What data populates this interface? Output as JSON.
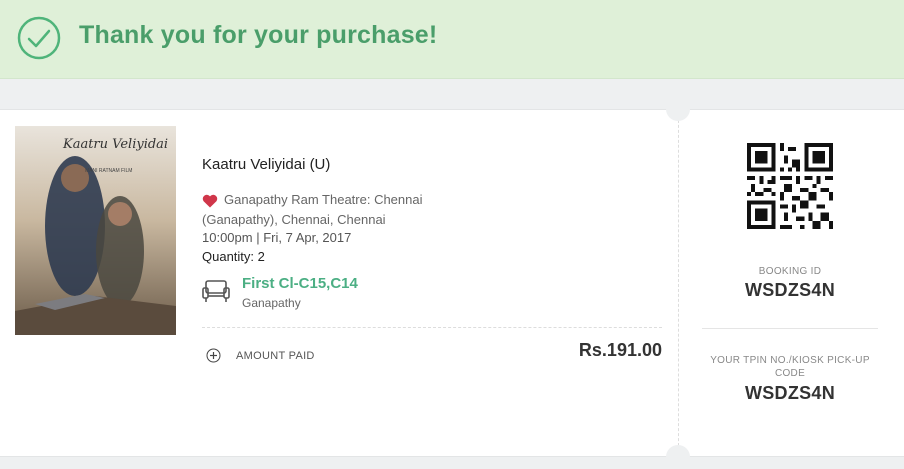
{
  "banner": {
    "title": "Thank you for your purchase!",
    "icon": "check-circle-icon",
    "color": "#4a9e6a"
  },
  "movie": {
    "title": "Kaatru Veliyidai (U)",
    "poster_title": "Kaatru Veliyidai",
    "poster_subtitle": "MANI RATNAM FILM",
    "theatre_line1": "Ganapathy Ram Theatre: Chennai",
    "theatre_line2": "(Ganapathy), Chennai, Chennai",
    "showtime": "10:00pm | Fri, 7 Apr, 2017",
    "quantity": "Quantity: 2",
    "seat_class": "First Cl-C15,C14",
    "screen": "Ganapathy"
  },
  "payment": {
    "label": "AMOUNT PAID",
    "value": "Rs.191.00"
  },
  "booking": {
    "id_label": "BOOKING ID",
    "id": "WSDZS4N",
    "tpin_label": "YOUR TPIN NO./KIOSK PICK-UP CODE",
    "tpin": "WSDZS4N"
  },
  "colors": {
    "accent_green": "#4caf84",
    "heart_red": "#d0364a"
  }
}
